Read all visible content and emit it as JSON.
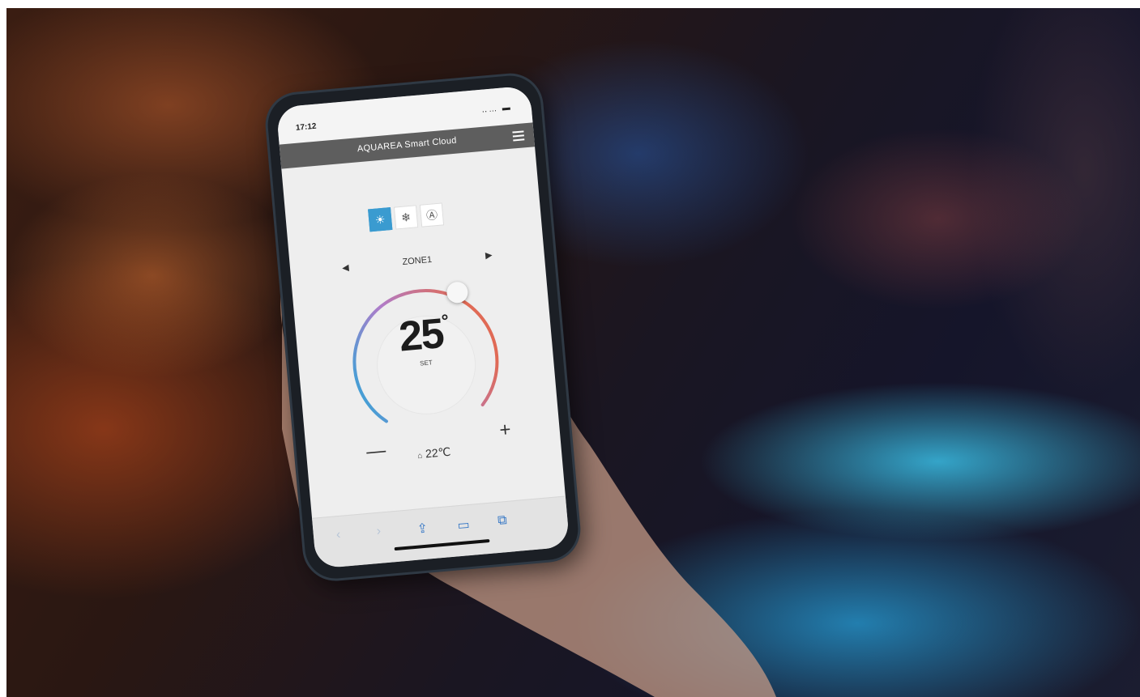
{
  "status_bar": {
    "time": "17:12",
    "icons": "‥… ▬"
  },
  "app": {
    "title": "AQUAREA Smart Cloud"
  },
  "modes": [
    {
      "name": "heat",
      "glyph": "☀",
      "active": true
    },
    {
      "name": "cool",
      "glyph": "❄",
      "active": false
    },
    {
      "name": "auto",
      "glyph": "Ⓐ",
      "active": false
    }
  ],
  "zone": {
    "label": "ZONE1",
    "prev": "◀",
    "next": "▶"
  },
  "setpoint": {
    "value": "25",
    "unit": "°",
    "label": "SET"
  },
  "controls": {
    "minus": "—",
    "plus": "+"
  },
  "room": {
    "icon": "⌂",
    "temp": "22℃"
  },
  "browser": {
    "back": "‹",
    "forward": "›",
    "share": "⇪",
    "bookmarks": "▭",
    "tabs": "⧉"
  },
  "colors": {
    "accent": "#3a9bd0",
    "arc_cold": "#2aa7d8",
    "arc_mid": "#b07cc9",
    "arc_warm": "#e06a55",
    "appbar": "#5e5e5e"
  }
}
